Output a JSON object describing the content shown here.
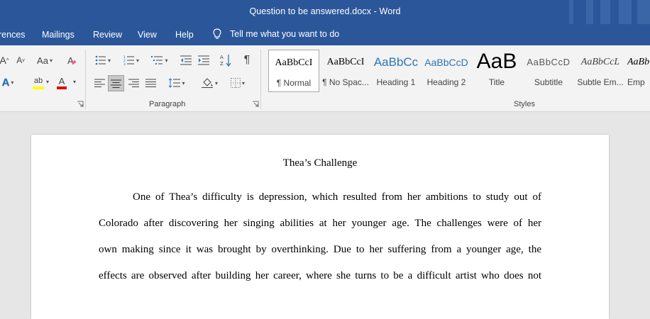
{
  "window": {
    "doc_name": "Question to be answered.docx",
    "separator": " - ",
    "app_name": "Word"
  },
  "tabs": [
    {
      "label": "rences"
    },
    {
      "label": "Mailings"
    },
    {
      "label": "Review"
    },
    {
      "label": "View"
    },
    {
      "label": "Help"
    }
  ],
  "tell_me": {
    "label": "Tell me what you want to do",
    "icon": "lightbulb-icon"
  },
  "ribbon": {
    "font_group": {
      "case_label": "Aa",
      "grow_font": "A",
      "shrink_font": "A",
      "clear_format": "A",
      "text_effects": "A",
      "highlight": "ab",
      "font_color": "A",
      "highlight_color": "#ffff00",
      "font_color_value": "#e00000"
    },
    "paragraph_group": {
      "label": "Paragraph",
      "pilcrow": "¶"
    },
    "styles_group": {
      "label": "Styles",
      "items": [
        {
          "preview": "AaBbCcI",
          "name": "¶ Normal"
        },
        {
          "preview": "AaBbCcI",
          "name": "¶ No Spac..."
        },
        {
          "preview": "AaBbCc",
          "name": "Heading 1"
        },
        {
          "preview": "AaBbCcD",
          "name": "Heading 2"
        },
        {
          "preview": "AaB",
          "name": "Title"
        },
        {
          "preview": "AaBbCcD",
          "name": "Subtitle"
        },
        {
          "preview": "AaBbCcL",
          "name": "Subtle Em..."
        },
        {
          "preview": "AaBb",
          "name": "Emp"
        }
      ]
    }
  },
  "document": {
    "title": "Thea’s Challenge",
    "lines": [
      "One of Thea’s difficulty is depression, which resulted from her ambitions to study out of",
      "Colorado after discovering her singing abilities at her younger age. The challenges were of her",
      "own making since it was brought by overthinking. Due to her suffering from a younger age, the",
      "effects are observed after building her career, where she turns to be a difficult artist who does not"
    ]
  },
  "colors": {
    "word_blue": "#2b579a",
    "ribbon_bg": "#f3f3f3",
    "doc_bg": "#e6e6e6"
  }
}
